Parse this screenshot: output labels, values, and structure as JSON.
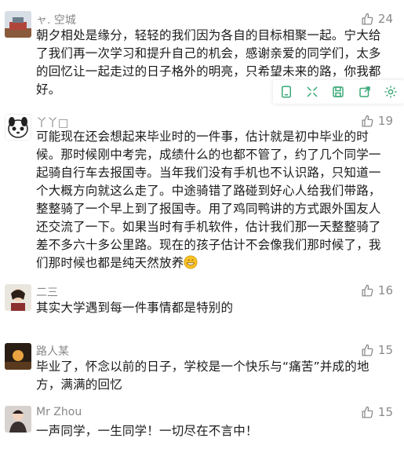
{
  "comments": [
    {
      "name": "ャ.  空城",
      "likes": "24",
      "text": "朝夕相处是缘分，轻轻的我们因为各自的目标相聚一起。宁大给了我们再一次学习和提升自己的机会，感谢亲爱的同学们，太多的回忆让一起走过的日子格外的明亮，只希望未来的路，你我都好。"
    },
    {
      "name": "丫丫□",
      "likes": "19",
      "text": "可能现在还会想起来毕业时的一件事，估计就是初中毕业的时候。那时候刚中考完，成绩什么的也都不管了，约了几个同学一起骑自行车去报国寺。当年我们没有手机也不认识路，只知道一个大概方向就这么走了。中途骑错了路碰到好心人给我们带路，整整骑了一个早上到了报国寺。用了鸡同鸭讲的方式跟外国友人还交流了一下。如果当时有手机软件，估计我们那一天整整骑了差不多六十多公里路。现在的孩子估计不会像我们那时候了，我们那时候也都是纯天然放养"
    },
    {
      "name": "二三",
      "likes": "16",
      "text": "其实大学遇到每一件事情都是特别的"
    },
    {
      "name": "路人某",
      "likes": "15",
      "text": "毕业了，怀念以前的日子，学校是一个快乐与“痛苦”并成的地方，满满的回忆"
    },
    {
      "name": "Mr Zhou",
      "likes": "15",
      "text": "一声同学，一生同学！一切尽在不言中！"
    }
  ],
  "toolbar_icons": [
    "copy-icon",
    "expand-icon",
    "save-icon",
    "share-icon",
    "settings-icon"
  ],
  "colors": {
    "name": "#888888",
    "text": "#1a1a1a",
    "like": "#8a8a8a",
    "toolbar_icon": "#3aa876"
  }
}
